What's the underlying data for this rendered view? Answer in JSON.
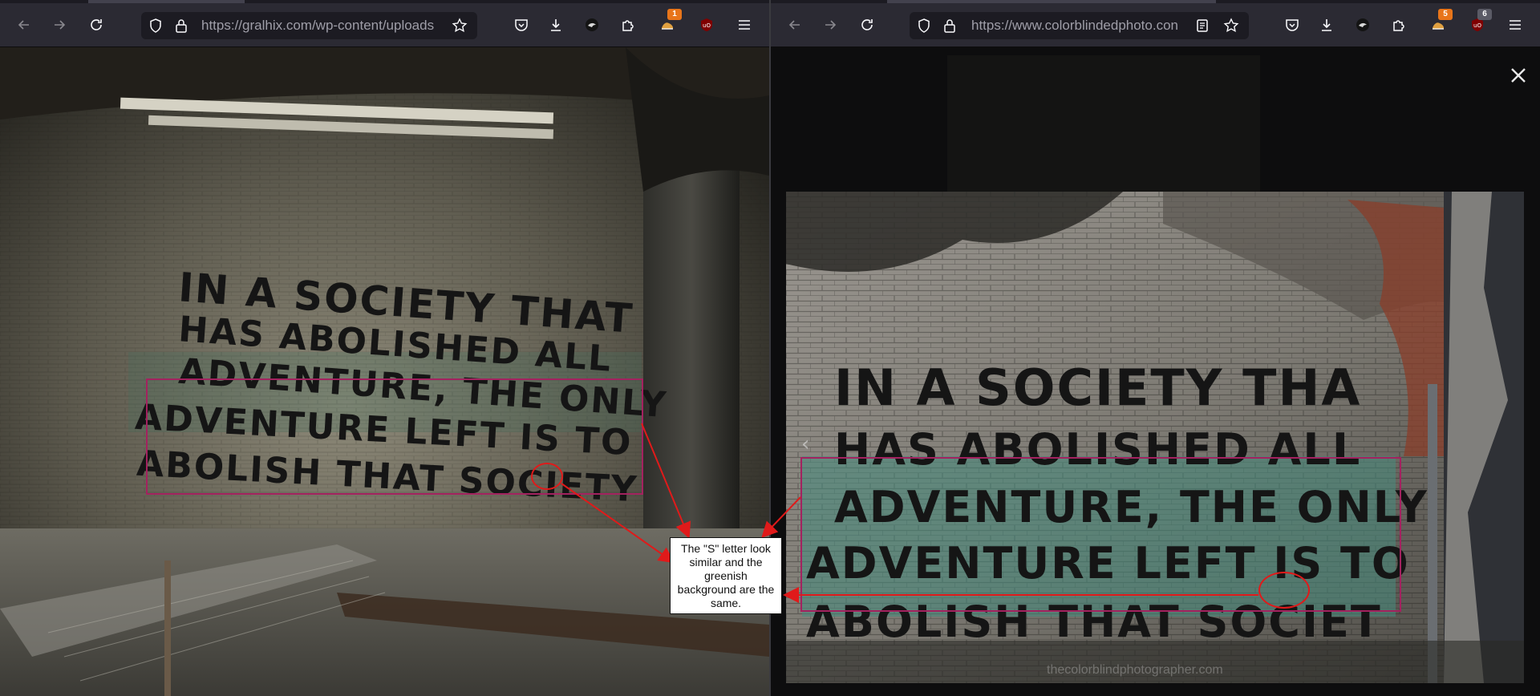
{
  "left_window": {
    "url": "https://gralhix.com/wp-content/uploads",
    "extension_badge": "1",
    "photo_text_lines": [
      "IN A SOCIETY THAT",
      "HAS ABOLISHED ALL",
      "ADVENTURE, THE ONLY",
      "ADVENTURE LEFT IS TO",
      "ABOLISH THAT SOCIETY"
    ]
  },
  "right_window": {
    "url": "https://www.colorblindedphoto.con",
    "extension_badge_1": "5",
    "extension_badge_2": "6",
    "photo_text_lines": [
      "IN A SOCIETY THA",
      "HAS ABOLISHED ALL",
      "ADVENTURE, THE ONLY",
      "ADVENTURE LEFT IS TO",
      "ABOLISH THAT SOCIET"
    ],
    "watermark": "thecolorblindphotographer.com"
  },
  "annotation": {
    "callout_text": "The \"S\" letter look similar and the greenish background are the same."
  },
  "icons": {
    "back": "arrow-left-icon",
    "forward": "arrow-right-icon",
    "reload": "reload-icon",
    "shield": "shield-icon",
    "lock": "lock-icon",
    "reader": "reader-view-icon",
    "bookmark": "star-icon",
    "pocket": "pocket-icon",
    "downloads": "download-icon",
    "extensions": "puzzle-icon",
    "menu": "hamburger-menu-icon",
    "close": "close-icon"
  },
  "colors": {
    "toolbar_bg": "#2b2a33",
    "urlbar_bg": "#1c1b22",
    "highlight_box": "#a3225f",
    "highlight_circle": "#e01a1a",
    "badge_orange": "#e8751a",
    "badge_gray": "#5b5b66"
  }
}
